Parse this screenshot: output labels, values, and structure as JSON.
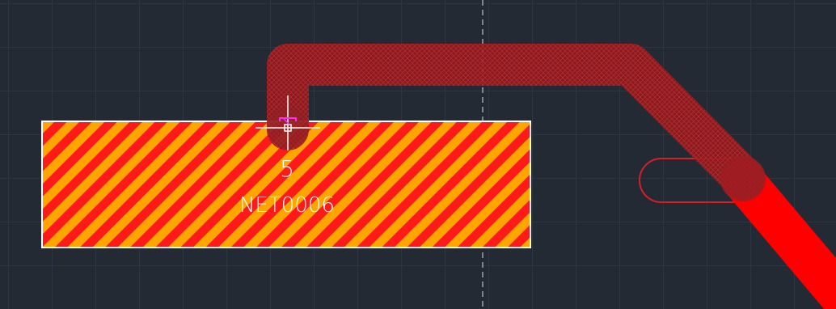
{
  "canvas": {
    "background": "#232a33",
    "grid_color": "#34404c",
    "guide_color": "#7d858d"
  },
  "pad": {
    "number": "5",
    "net_name": "NET0006",
    "hatch_color_a": "#ff1a1a",
    "hatch_color_b": "#ffa500",
    "outline_color": "#ffffff",
    "label_color": "#ffffff"
  },
  "traces": {
    "highlighted_color": "#b01e22",
    "solid_color": "#ff0000"
  },
  "slot_hole": {
    "outline_color": "#d61f26"
  },
  "cursor": {
    "crosshair_color": "#ffffff",
    "marker_color": "#ff2aff"
  }
}
